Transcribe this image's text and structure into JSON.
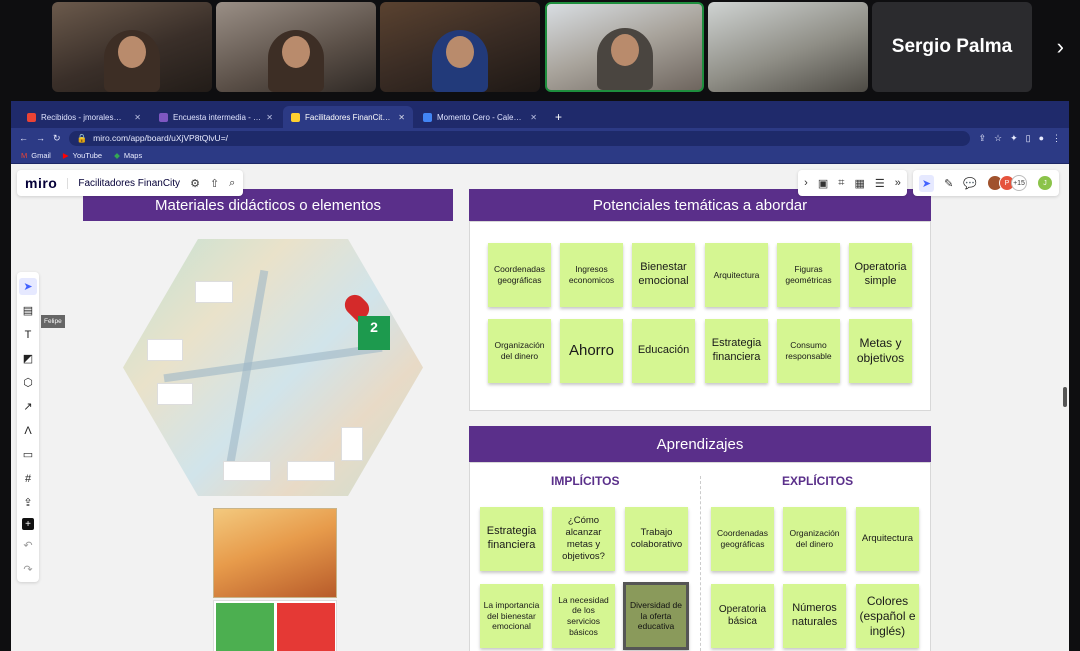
{
  "call": {
    "participant_name": "Sergio Palma"
  },
  "browser": {
    "tabs": [
      {
        "label": "Recibidos - jmorales@momento",
        "color": "#ea4335"
      },
      {
        "label": "Encuesta intermedia - Formula",
        "color": "#7e57c2"
      },
      {
        "label": "Facilitadores FinanCity, Online",
        "color": "#ffd02f"
      },
      {
        "label": "Momento Cero - Calendar - Se",
        "color": "#4285f4"
      }
    ],
    "url": "miro.com/app/board/uXjVP8tQlvU=/",
    "bookmarks": [
      "Gmail",
      "YouTube",
      "Maps"
    ]
  },
  "miro": {
    "logo": "miro",
    "board_name": "Facilitadores FinanCity",
    "collaborators_more": "+15",
    "cursor_label": "Felipe",
    "materials_title": "Materiales didácticos o elementos",
    "sdg_number": "2",
    "topics_title": "Potenciales temáticas a abordar",
    "topics": [
      "Coordenadas geográficas",
      "Ingresos economicos",
      "Bienestar emocional",
      "Arquitectura",
      "Figuras geométricas",
      "Operatoria simple",
      "Organización del dinero",
      "Ahorro",
      "Educación",
      "Estrategia financiera",
      "Consumo responsable",
      "Metas y objetivos"
    ],
    "learning_title": "Aprendizajes",
    "implicit_title": "IMPLÍCITOS",
    "explicit_title": "EXPLÍCITOS",
    "implicit": [
      "Estrategia financiera",
      "¿Cómo alcanzar metas y objetivos?",
      "Trabajo colaborativo",
      "La importancia del bienestar emocional",
      "La necesidad de los servicios básicos",
      "Diversidad de la oferta educativa"
    ],
    "explicit": [
      "Coordenadas geográficas",
      "Organización del dinero",
      "Arquitectura",
      "Operatoria básica",
      "Números naturales",
      "Colores (español e inglés)"
    ]
  }
}
